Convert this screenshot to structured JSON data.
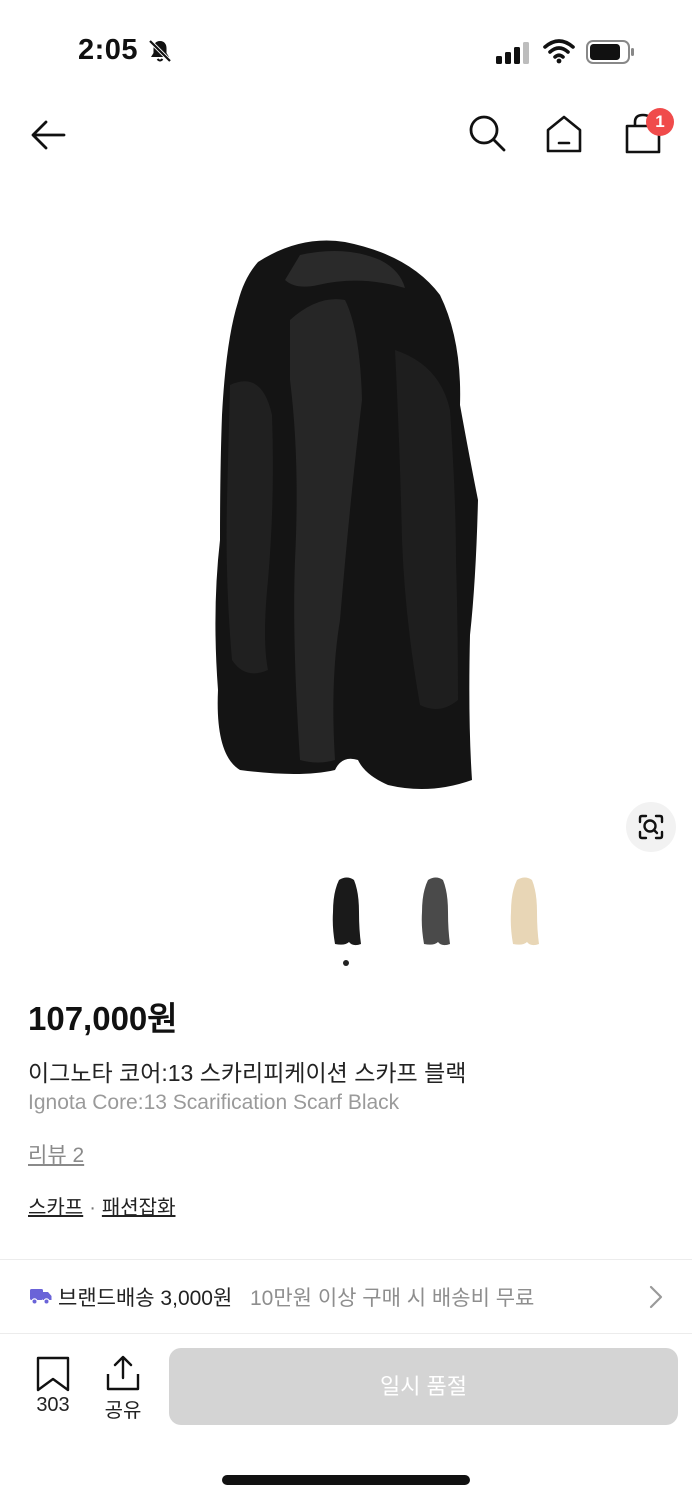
{
  "status_bar": {
    "time": "2:05"
  },
  "nav": {
    "cart_badge": "1"
  },
  "product": {
    "price": "107,000원",
    "name_ko": "이그노타 코어:13 스카리피케이션 스카프 블랙",
    "name_en": "Ignota Core:13 Scarification Scarf Black",
    "review": "리뷰 2",
    "categories": [
      "스카프",
      "패션잡화"
    ],
    "category_separator": "·",
    "thumbnails": [
      {
        "color_name": "black",
        "color": "#1a1a1a"
      },
      {
        "color_name": "gray",
        "color": "#4a4a4a"
      },
      {
        "color_name": "beige",
        "color": "#e8d6b6"
      }
    ],
    "selected_thumbnail": 0
  },
  "shipping": {
    "label": "브랜드배송 3,000원",
    "note": "10만원 이상 구매 시 배송비 무료",
    "truck_color": "#6a63d8"
  },
  "bottom_bar": {
    "bookmark_count": "303",
    "share_label": "공유",
    "soldout_label": "일시 품절"
  }
}
